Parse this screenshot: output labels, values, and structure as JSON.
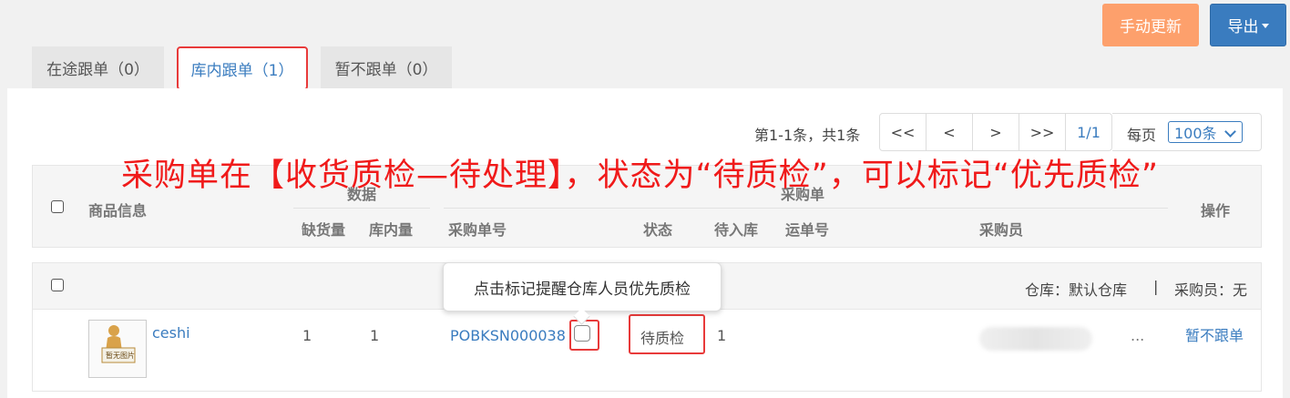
{
  "toolbar": {
    "manual_update_label": "手动更新",
    "export_label": "导出"
  },
  "tabs": [
    {
      "label": "在途跟单（0）",
      "active": false
    },
    {
      "label": "库内跟单（1）",
      "active": true
    },
    {
      "label": "暂不跟单（0）",
      "active": false
    }
  ],
  "pagination": {
    "summary": "第1-1条，共1条",
    "first": "<<",
    "prev": "<",
    "next": ">",
    "last": ">>",
    "page": "1/1",
    "per_page_label": "每页",
    "per_page_value": "100条"
  },
  "annotation": "采购单在【收货质检—待处理】，状态为“待质检”，可以标记“优先质检”",
  "table": {
    "headers": {
      "product_info": "商品信息",
      "data_group": "数据",
      "shortage": "缺货量",
      "in_stock": "库内量",
      "purchase_group": "采购单",
      "purchase_no": "采购单号",
      "status": "状态",
      "pending_in": "待入库",
      "tracking_no": "运单号",
      "buyer": "采购员",
      "actions": "操作"
    },
    "group_row": {
      "warehouse": "仓库：默认仓库",
      "separator": "|",
      "buyer": "采购员：无"
    },
    "rows": [
      {
        "product_name": "ceshi",
        "thumb_caption": "暂无图片",
        "shortage": "1",
        "in_stock": "1",
        "purchase_no": "POBKSN000038",
        "status": "待质检",
        "pending_in": "1",
        "ellipsis": "...",
        "action": "暂不跟单"
      }
    ]
  },
  "tooltip": "点击标记提醒仓库人员优先质检"
}
